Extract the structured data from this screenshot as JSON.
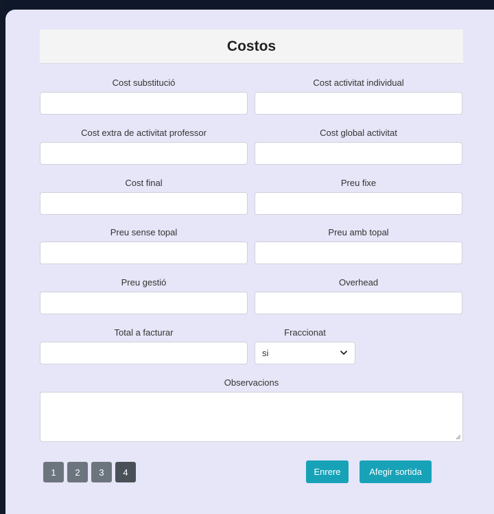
{
  "form": {
    "title": "Costos",
    "fields": [
      {
        "label": "Cost substitució",
        "value": ""
      },
      {
        "label": "Cost activitat individual",
        "value": ""
      },
      {
        "label": "Cost extra de activitat professor",
        "value": ""
      },
      {
        "label": "Cost global activitat",
        "value": ""
      },
      {
        "label": "Cost final",
        "value": ""
      },
      {
        "label": "Preu fixe",
        "value": ""
      },
      {
        "label": "Preu sense topal",
        "value": ""
      },
      {
        "label": "Preu amb topal",
        "value": ""
      },
      {
        "label": "Preu gestió",
        "value": ""
      },
      {
        "label": "Overhead",
        "value": ""
      },
      {
        "label": "Total a facturar",
        "value": ""
      }
    ],
    "fraccionat": {
      "label": "Fraccionat",
      "selected": "si"
    },
    "observacions": {
      "label": "Observacions",
      "value": ""
    }
  },
  "pagination": {
    "pages": [
      "1",
      "2",
      "3",
      "4"
    ],
    "active": "4"
  },
  "actions": {
    "back_label": "Enrere",
    "add_label": "Afegir sortida"
  },
  "colors": {
    "accent": "#17a2b8",
    "card_bg": "#e6e6f8",
    "page_btn": "#6c757d",
    "page_btn_active": "#495057"
  }
}
